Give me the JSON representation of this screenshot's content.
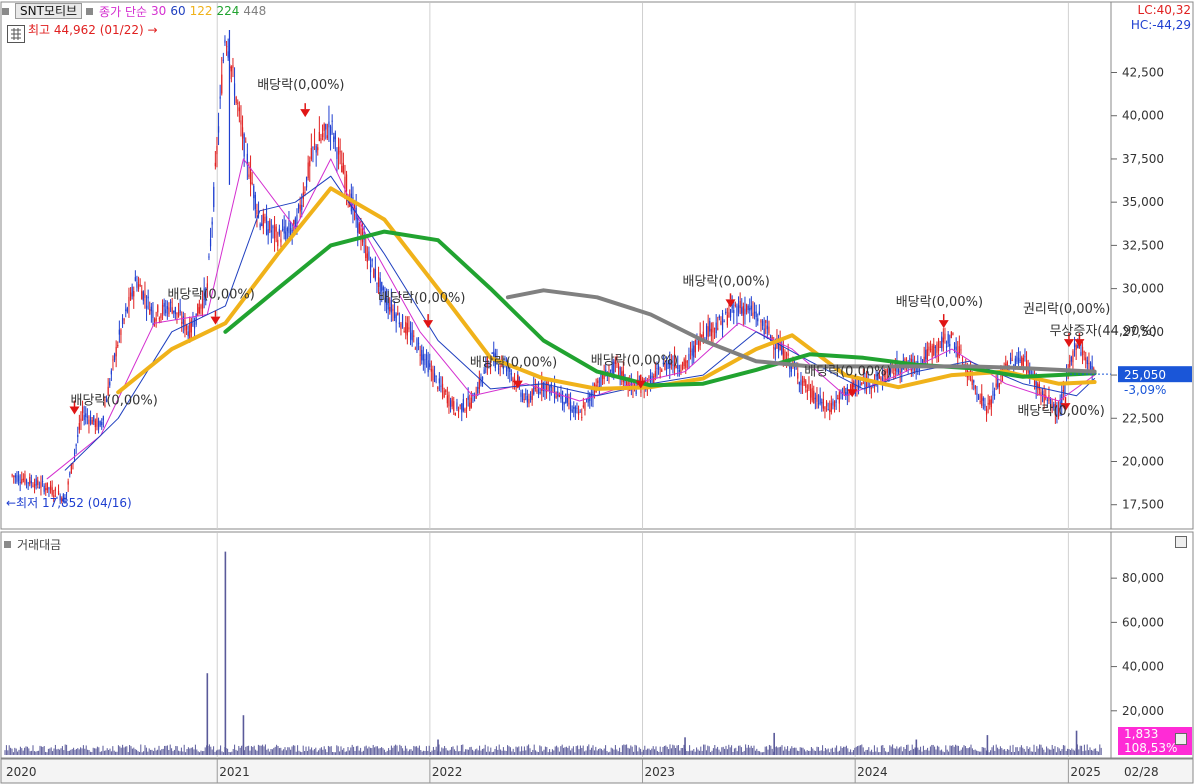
{
  "header": {
    "symbol": "SNT모티브",
    "ma_label": "종가 단순",
    "ma_periods": [
      {
        "label": "30",
        "color": "#d42fd0"
      },
      {
        "label": "60",
        "color": "#1f3fbf"
      },
      {
        "label": "122",
        "color": "#f0b21a"
      },
      {
        "label": "224",
        "color": "#21a330"
      },
      {
        "label": "448",
        "color": "#808080"
      }
    ],
    "lc": "LC:40,32",
    "hc": "HC:-44,29"
  },
  "price_panel": {
    "y_ticks": [
      "42,500",
      "40,000",
      "37,500",
      "35,000",
      "32,500",
      "30,000",
      "27,500",
      "25,000",
      "22,500",
      "20,000",
      "17,500"
    ],
    "current_price": "25,050",
    "current_change": "-3,09%",
    "high_label": "최고 44,962 (01/22) →",
    "low_label": "←최저 17,852 (04/16)"
  },
  "volume_panel": {
    "title": "거래대금",
    "y_ticks": [
      "80,000",
      "60,000",
      "40,000",
      "20,000"
    ],
    "current_value": "1,833",
    "current_pct": "108,53%"
  },
  "x_axis": {
    "labels": [
      "2020",
      "2021",
      "2022",
      "2023",
      "2024",
      "2025"
    ],
    "end_label": "02/28"
  },
  "annotations": [
    {
      "text": "배당락(0,00%)"
    },
    {
      "text": "배당락(0,00%)"
    },
    {
      "text": "배당락(0,00%)"
    },
    {
      "text": "배당락(0,00%)"
    },
    {
      "text": "배당락(0,00%)"
    },
    {
      "text": "배당락(0,00%)"
    },
    {
      "text": "배당락(0,00%)"
    },
    {
      "text": "배당락(0,00%)"
    },
    {
      "text": "배당락(0,00%)"
    },
    {
      "text": "배당락(0,00%)"
    },
    {
      "text": "권리락(0,00%)"
    },
    {
      "text": "무상증자(44,90%)"
    }
  ],
  "colors": {
    "up": "#e02020",
    "down": "#1f3fd0",
    "volume": "#5a5a9a",
    "highlight_price": "#1a56d8",
    "highlight_volume": "#ff2bd6",
    "annotation_text": "#333333",
    "arrow": "#e01515"
  },
  "chart_data": {
    "type": "line",
    "title": "SNT모티브",
    "y_range": [
      16500,
      46000
    ],
    "y_ticks": [
      17500,
      20000,
      22500,
      25000,
      27500,
      30000,
      32500,
      35000,
      37500,
      40000,
      42500
    ],
    "close": [
      {
        "x": "2020-01",
        "y": 19200
      },
      {
        "x": "2020-03",
        "y": 18500
      },
      {
        "x": "2020-04",
        "y": 17852
      },
      {
        "x": "2020-05",
        "y": 22800
      },
      {
        "x": "2020-06",
        "y": 22000
      },
      {
        "x": "2020-07",
        "y": 27000
      },
      {
        "x": "2020-08",
        "y": 30500
      },
      {
        "x": "2020-09",
        "y": 28500
      },
      {
        "x": "2020-10",
        "y": 29000
      },
      {
        "x": "2020-11",
        "y": 27500
      },
      {
        "x": "2020-12",
        "y": 30000
      },
      {
        "x": "2021-01",
        "y": 44962
      },
      {
        "x": "2021-02",
        "y": 38500
      },
      {
        "x": "2021-03",
        "y": 34000
      },
      {
        "x": "2021-04",
        "y": 33000
      },
      {
        "x": "2021-05",
        "y": 33500
      },
      {
        "x": "2021-06",
        "y": 38000
      },
      {
        "x": "2021-07",
        "y": 39500
      },
      {
        "x": "2021-08",
        "y": 35500
      },
      {
        "x": "2021-09",
        "y": 32000
      },
      {
        "x": "2021-10",
        "y": 29500
      },
      {
        "x": "2021-11",
        "y": 28000
      },
      {
        "x": "2021-12",
        "y": 26500
      },
      {
        "x": "2022-01",
        "y": 24500
      },
      {
        "x": "2022-02",
        "y": 23000
      },
      {
        "x": "2022-03",
        "y": 23500
      },
      {
        "x": "2022-04",
        "y": 26000
      },
      {
        "x": "2022-05",
        "y": 25500
      },
      {
        "x": "2022-06",
        "y": 23500
      },
      {
        "x": "2022-07",
        "y": 24500
      },
      {
        "x": "2022-08",
        "y": 23800
      },
      {
        "x": "2022-09",
        "y": 22600
      },
      {
        "x": "2022-10",
        "y": 24500
      },
      {
        "x": "2022-11",
        "y": 25500
      },
      {
        "x": "2022-12",
        "y": 24200
      },
      {
        "x": "2023-01",
        "y": 24600
      },
      {
        "x": "2023-02",
        "y": 25800
      },
      {
        "x": "2023-03",
        "y": 25500
      },
      {
        "x": "2023-04",
        "y": 27500
      },
      {
        "x": "2023-05",
        "y": 28000
      },
      {
        "x": "2023-06",
        "y": 29000
      },
      {
        "x": "2023-07",
        "y": 28500
      },
      {
        "x": "2023-08",
        "y": 27000
      },
      {
        "x": "2023-09",
        "y": 25500
      },
      {
        "x": "2023-10",
        "y": 24000
      },
      {
        "x": "2023-11",
        "y": 23000
      },
      {
        "x": "2023-12",
        "y": 24000
      },
      {
        "x": "2024-01",
        "y": 24500
      },
      {
        "x": "2024-02",
        "y": 24800
      },
      {
        "x": "2024-03",
        "y": 25500
      },
      {
        "x": "2024-04",
        "y": 25600
      },
      {
        "x": "2024-05",
        "y": 26500
      },
      {
        "x": "2024-06",
        "y": 27200
      },
      {
        "x": "2024-07",
        "y": 25000
      },
      {
        "x": "2024-08",
        "y": 23000
      },
      {
        "x": "2024-09",
        "y": 25500
      },
      {
        "x": "2024-10",
        "y": 26000
      },
      {
        "x": "2024-11",
        "y": 24000
      },
      {
        "x": "2024-12",
        "y": 22800
      },
      {
        "x": "2025-01",
        "y": 27000
      },
      {
        "x": "2025-02",
        "y": 25050
      }
    ],
    "series": [
      {
        "name": "30",
        "values": [
          {
            "x": "2020-03",
            "y": 19000
          },
          {
            "x": "2020-06",
            "y": 21500
          },
          {
            "x": "2020-09",
            "y": 28000
          },
          {
            "x": "2020-12",
            "y": 28500
          },
          {
            "x": "2021-02",
            "y": 37500
          },
          {
            "x": "2021-05",
            "y": 33500
          },
          {
            "x": "2021-07",
            "y": 37500
          },
          {
            "x": "2021-09",
            "y": 33000
          },
          {
            "x": "2021-12",
            "y": 27500
          },
          {
            "x": "2022-03",
            "y": 23800
          },
          {
            "x": "2022-06",
            "y": 24500
          },
          {
            "x": "2022-09",
            "y": 23500
          },
          {
            "x": "2022-12",
            "y": 24500
          },
          {
            "x": "2023-03",
            "y": 25200
          },
          {
            "x": "2023-06",
            "y": 28000
          },
          {
            "x": "2023-09",
            "y": 26500
          },
          {
            "x": "2023-12",
            "y": 23800
          },
          {
            "x": "2024-03",
            "y": 25000
          },
          {
            "x": "2024-06",
            "y": 26500
          },
          {
            "x": "2024-09",
            "y": 24500
          },
          {
            "x": "2024-12",
            "y": 23500
          },
          {
            "x": "2025-02",
            "y": 25000
          }
        ]
      },
      {
        "name": "60",
        "values": [
          {
            "x": "2020-04",
            "y": 19500
          },
          {
            "x": "2020-07",
            "y": 22500
          },
          {
            "x": "2020-10",
            "y": 27500
          },
          {
            "x": "2021-01",
            "y": 29000
          },
          {
            "x": "2021-03",
            "y": 34500
          },
          {
            "x": "2021-05",
            "y": 35000
          },
          {
            "x": "2021-07",
            "y": 36500
          },
          {
            "x": "2021-10",
            "y": 32000
          },
          {
            "x": "2022-01",
            "y": 27000
          },
          {
            "x": "2022-04",
            "y": 24200
          },
          {
            "x": "2022-07",
            "y": 24500
          },
          {
            "x": "2022-10",
            "y": 23800
          },
          {
            "x": "2023-01",
            "y": 24500
          },
          {
            "x": "2023-04",
            "y": 25000
          },
          {
            "x": "2023-07",
            "y": 27500
          },
          {
            "x": "2023-10",
            "y": 25800
          },
          {
            "x": "2024-01",
            "y": 24200
          },
          {
            "x": "2024-04",
            "y": 25200
          },
          {
            "x": "2024-07",
            "y": 25800
          },
          {
            "x": "2024-10",
            "y": 24500
          },
          {
            "x": "2025-01",
            "y": 23800
          },
          {
            "x": "2025-02",
            "y": 24800
          }
        ]
      },
      {
        "name": "122",
        "values": [
          {
            "x": "2020-07",
            "y": 24000
          },
          {
            "x": "2020-10",
            "y": 26500
          },
          {
            "x": "2021-01",
            "y": 28000
          },
          {
            "x": "2021-04",
            "y": 32000
          },
          {
            "x": "2021-07",
            "y": 35800
          },
          {
            "x": "2021-10",
            "y": 34000
          },
          {
            "x": "2022-01",
            "y": 30000
          },
          {
            "x": "2022-04",
            "y": 26000
          },
          {
            "x": "2022-07",
            "y": 24800
          },
          {
            "x": "2022-10",
            "y": 24200
          },
          {
            "x": "2023-01",
            "y": 24300
          },
          {
            "x": "2023-04",
            "y": 24800
          },
          {
            "x": "2023-07",
            "y": 26500
          },
          {
            "x": "2023-09",
            "y": 27300
          },
          {
            "x": "2023-12",
            "y": 25000
          },
          {
            "x": "2024-03",
            "y": 24300
          },
          {
            "x": "2024-06",
            "y": 25000
          },
          {
            "x": "2024-09",
            "y": 25200
          },
          {
            "x": "2024-12",
            "y": 24500
          },
          {
            "x": "2025-02",
            "y": 24600
          }
        ]
      },
      {
        "name": "224",
        "values": [
          {
            "x": "2021-01",
            "y": 27500
          },
          {
            "x": "2021-04",
            "y": 30000
          },
          {
            "x": "2021-07",
            "y": 32500
          },
          {
            "x": "2021-10",
            "y": 33300
          },
          {
            "x": "2022-01",
            "y": 32800
          },
          {
            "x": "2022-04",
            "y": 30000
          },
          {
            "x": "2022-07",
            "y": 27000
          },
          {
            "x": "2022-10",
            "y": 25200
          },
          {
            "x": "2023-01",
            "y": 24400
          },
          {
            "x": "2023-04",
            "y": 24500
          },
          {
            "x": "2023-07",
            "y": 25300
          },
          {
            "x": "2023-10",
            "y": 26200
          },
          {
            "x": "2024-01",
            "y": 26000
          },
          {
            "x": "2024-04",
            "y": 25600
          },
          {
            "x": "2024-07",
            "y": 25400
          },
          {
            "x": "2024-10",
            "y": 24900
          },
          {
            "x": "2025-02",
            "y": 25100
          }
        ]
      },
      {
        "name": "448",
        "values": [
          {
            "x": "2022-05",
            "y": 29500
          },
          {
            "x": "2022-07",
            "y": 29900
          },
          {
            "x": "2022-10",
            "y": 29500
          },
          {
            "x": "2023-01",
            "y": 28500
          },
          {
            "x": "2023-04",
            "y": 27000
          },
          {
            "x": "2023-07",
            "y": 25800
          },
          {
            "x": "2023-10",
            "y": 25500
          },
          {
            "x": "2024-01",
            "y": 25500
          },
          {
            "x": "2024-04",
            "y": 25500
          },
          {
            "x": "2024-07",
            "y": 25500
          },
          {
            "x": "2024-10",
            "y": 25400
          },
          {
            "x": "2025-02",
            "y": 25200
          }
        ]
      }
    ],
    "volume": {
      "y_range": [
        0,
        95000
      ],
      "y_ticks": [
        20000,
        40000,
        60000,
        80000
      ],
      "spikes": [
        {
          "x": "2020-12",
          "y": 37000
        },
        {
          "x": "2021-01",
          "y": 92000
        },
        {
          "x": "2021-02",
          "y": 18000
        },
        {
          "x": "2022-01",
          "y": 7000
        },
        {
          "x": "2023-03",
          "y": 8000
        },
        {
          "x": "2023-08",
          "y": 10000
        },
        {
          "x": "2024-04",
          "y": 7000
        },
        {
          "x": "2024-08",
          "y": 9000
        },
        {
          "x": "2025-01",
          "y": 11000
        }
      ],
      "baseline": 3000
    }
  }
}
